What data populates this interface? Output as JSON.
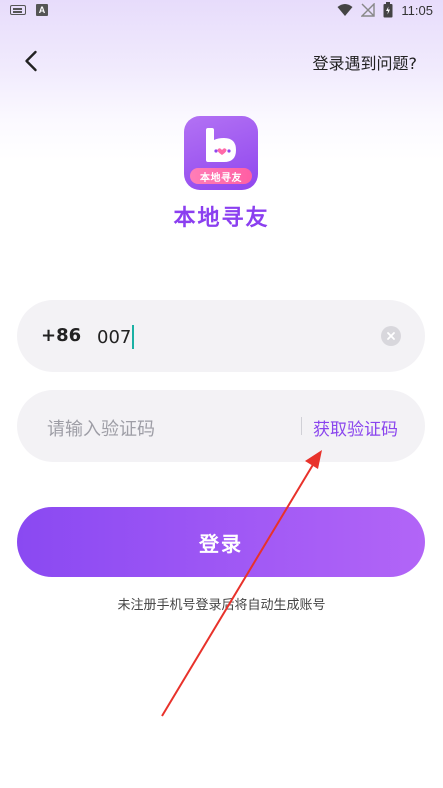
{
  "status_bar": {
    "time": "11:05",
    "left_icons": [
      "keyboard-icon",
      "a-icon"
    ],
    "a_label": "A",
    "right_icons": [
      "wifi-icon",
      "no-signal-icon",
      "battery-icon"
    ]
  },
  "header": {
    "back_icon": "chevron-left-icon",
    "help_link": "登录遇到问题?"
  },
  "logo": {
    "badge_text": "本地寻友",
    "app_name": "本地寻友"
  },
  "phone_input": {
    "country_code": "+86",
    "value": "007",
    "clear_icon": "clear-icon"
  },
  "code_input": {
    "placeholder": "请输入验证码",
    "get_code_label": "获取验证码"
  },
  "login": {
    "button_label": "登录",
    "hint": "未注册手机号登录后将自动生成账号"
  },
  "colors": {
    "accent": "#8a45ee",
    "annotation": "#e8322b"
  }
}
